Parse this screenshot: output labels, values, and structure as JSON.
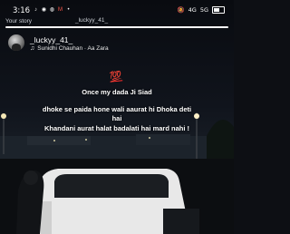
{
  "status": {
    "time": "3:16",
    "network": "4G",
    "signal": "5G",
    "battery_level": 0.55
  },
  "header": {
    "your_story": "Your story",
    "top_user": "_luckyy_41_"
  },
  "story": {
    "username": "_luckyy_41_",
    "music": "Sunidhi Chauhan · Aa Zara",
    "emoji": "💯",
    "lines": [
      "Once  my dada Ji Siad",
      "dhoke se paida hone wali aaurat hi Dhoka deti",
      "hai",
      "Khandani aurat halat badalati hai mard nahi !"
    ]
  },
  "icons": [
    "tiktok-icon",
    "snapchat-icon",
    "messenger-icon",
    "gmail-icon",
    "mute-icon",
    "battery-icon",
    "music-note-icon"
  ]
}
